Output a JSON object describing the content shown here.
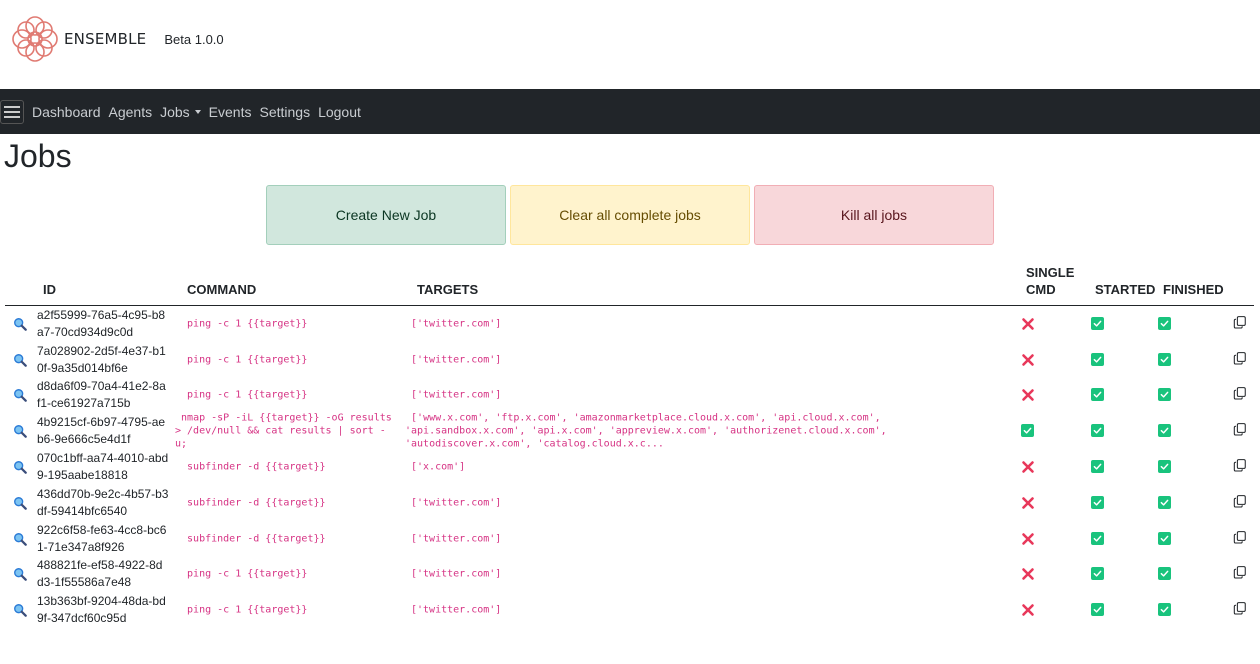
{
  "brand": {
    "name": "ENSEMBLE",
    "version": "Beta 1.0.0"
  },
  "nav": {
    "items": [
      {
        "label": "Dashboard"
      },
      {
        "label": "Agents"
      },
      {
        "label": "Jobs",
        "dropdown": true
      },
      {
        "label": "Events"
      },
      {
        "label": "Settings"
      },
      {
        "label": "Logout"
      }
    ]
  },
  "page": {
    "title": "Jobs"
  },
  "actions": {
    "create": "Create New Job",
    "clear": "Clear all complete jobs",
    "kill": "Kill all jobs"
  },
  "table": {
    "headers": {
      "id": "ID",
      "command": "COMMAND",
      "targets": "TARGETS",
      "single_cmd": "SINGLE\nCMD",
      "started": "STARTED",
      "finished": "FINISHED"
    },
    "rows": [
      {
        "id": "a2f55999-76a5-4c95-b8a7-70cd934d9c0d",
        "command": " ping -c 1 {{target}}",
        "targets": "['twitter.com']",
        "single_cmd": false,
        "started": true,
        "finished": true
      },
      {
        "id": "7a028902-2d5f-4e37-b10f-9a35d014bf6e",
        "command": " ping -c 1 {{target}}",
        "targets": "['twitter.com']",
        "single_cmd": false,
        "started": true,
        "finished": true
      },
      {
        "id": "d8da6f09-70a4-41e2-8af1-ce61927a715b",
        "command": " ping -c 1 {{target}}",
        "targets": "['twitter.com']",
        "single_cmd": false,
        "started": true,
        "finished": true
      },
      {
        "id": "4b9215cf-6b97-4795-aeb6-9e666c5e4d1f",
        "command": " nmap -sP -iL {{target}} -oG results\n> /dev/null && cat results | sort -\nu;",
        "targets": " ['www.x.com', 'ftp.x.com', 'amazonmarketplace.cloud.x.com', 'api.cloud.x.com',\n'api.sandbox.x.com', 'api.x.com', 'appreview.x.com', 'authorizenet.cloud.x.com',\n'autodiscover.x.com', 'catalog.cloud.x.c...",
        "single_cmd": true,
        "started": true,
        "finished": true
      },
      {
        "id": "070c1bff-aa74-4010-abd9-195aabe18818",
        "command": " subfinder -d {{target}}",
        "targets": "['x.com']",
        "single_cmd": false,
        "started": true,
        "finished": true
      },
      {
        "id": "436dd70b-9e2c-4b57-b3df-59414bfc6540",
        "command": " subfinder -d {{target}}",
        "targets": "['twitter.com']",
        "single_cmd": false,
        "started": true,
        "finished": true
      },
      {
        "id": "922c6f58-fe63-4cc8-bc61-71e347a8f926",
        "command": " subfinder -d {{target}}",
        "targets": "['twitter.com']",
        "single_cmd": false,
        "started": true,
        "finished": true
      },
      {
        "id": "488821fe-ef58-4922-8dd3-1f55586a7e48",
        "command": " ping -c 1 {{target}}",
        "targets": "['twitter.com']",
        "single_cmd": false,
        "started": true,
        "finished": true
      },
      {
        "id": "13b363bf-9204-48da-bd9f-347dcf60c95d",
        "command": " ping -c 1 {{target}}",
        "targets": "['twitter.com']",
        "single_cmd": false,
        "started": true,
        "finished": true
      }
    ]
  },
  "colors": {
    "navbar": "#212529",
    "code": "#d63384",
    "check": "#19c37d",
    "cross": "#e8375a",
    "logo": "#e07a72"
  },
  "icons": {
    "details": "magnifier-icon",
    "copy": "copy-icon",
    "yes": "check-icon",
    "no": "x-icon"
  }
}
